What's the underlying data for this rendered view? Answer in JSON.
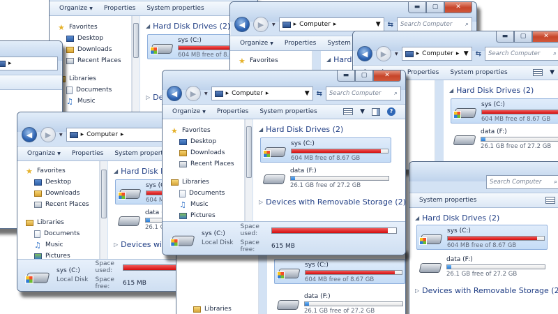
{
  "location": "Computer",
  "search_placeholder": "Search Computer",
  "toolbar": {
    "organize": "Organize",
    "properties": "Properties",
    "system_properties": "System properties"
  },
  "nav": {
    "favorites": "Favorites",
    "desktop": "Desktop",
    "downloads": "Downloads",
    "recent_places": "Recent Places",
    "libraries": "Libraries",
    "documents": "Documents",
    "music": "Music",
    "pictures": "Pictures"
  },
  "groups": {
    "hard_disk_drives": "Hard Disk Drives (2)",
    "removable": "Devices with Removable Storage (2)"
  },
  "drives": [
    {
      "name": "sys (C:)",
      "free_text": "604 MB free of 8.67 GB",
      "used_fraction": 0.93,
      "color": "#d9140f"
    },
    {
      "name": "data (F:)",
      "free_text": "26.1 GB free of 27.2 GB",
      "used_fraction": 0.04,
      "color": "#2a7cd6"
    }
  ],
  "details": {
    "name": "sys (C:)",
    "type": "Local Disk",
    "space_used_label": "Space used:",
    "space_free_label": "Space free:",
    "space_free_value": "615 MB",
    "used_fraction": 0.93
  },
  "icons": {
    "back": "back-arrow-icon",
    "forward": "forward-arrow-icon",
    "computer": "computer-icon",
    "refresh": "refresh-icon",
    "search": "search-icon",
    "drive": "hard-drive-icon"
  }
}
